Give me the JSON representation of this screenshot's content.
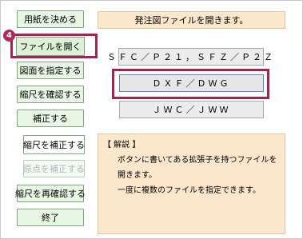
{
  "sidebar": {
    "items": [
      {
        "label": "用紙を決める"
      },
      {
        "label": "ファイルを開く"
      },
      {
        "label": "図面を指定する"
      },
      {
        "label": "縮尺を確認する"
      },
      {
        "label": "補正する"
      },
      {
        "label": "縮尺を補正する"
      },
      {
        "label": "原点を補正する"
      },
      {
        "label": "縮尺を再確認する"
      },
      {
        "label": "終了"
      }
    ]
  },
  "step_badge": "4",
  "message": "発注図ファイルを開きます。",
  "formats": [
    {
      "label": "ＳＦＣ／Ｐ２１，ＳＦＺ／Ｐ２Ｚ"
    },
    {
      "label": "ＤＸＦ／ＤＷＧ"
    },
    {
      "label": "ＪＷＣ／ＪＷＷ"
    }
  ],
  "help": {
    "title": "【 解説 】",
    "lines": [
      "ボタンに書いてある拡張子を持つファイルを",
      "開きます。",
      "一度に複数のファイルを指定できます。"
    ]
  },
  "colors": {
    "highlight": "#a3254e",
    "panel_bg": "#fde7cc",
    "sidebar_button_bg": "#e8f7e4"
  }
}
